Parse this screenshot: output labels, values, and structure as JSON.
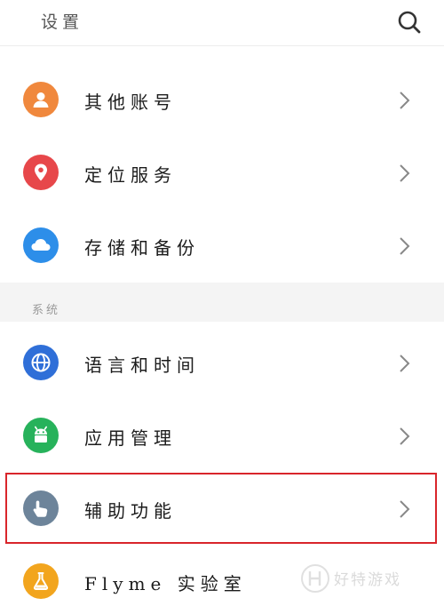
{
  "header": {
    "title": "设置"
  },
  "items": [
    {
      "label": "其他账号",
      "color": "#f0883d",
      "icon": "account-icon"
    },
    {
      "label": "定位服务",
      "color": "#e7474a",
      "icon": "location-icon"
    },
    {
      "label": "存储和备份",
      "color": "#2d8ee9",
      "icon": "cloud-icon"
    },
    {
      "label": "语言和时间",
      "color": "#2f6fd8",
      "icon": "globe-icon"
    },
    {
      "label": "应用管理",
      "color": "#27b25b",
      "icon": "android-icon"
    },
    {
      "label": "辅助功能",
      "color": "#6d849a",
      "icon": "hand-pointer-icon"
    },
    {
      "label": "Flyme 实验室",
      "color": "#f2a51e",
      "icon": "flask-icon"
    }
  ],
  "section": {
    "label": "系统"
  },
  "watermark": {
    "text": "好特游戏"
  }
}
